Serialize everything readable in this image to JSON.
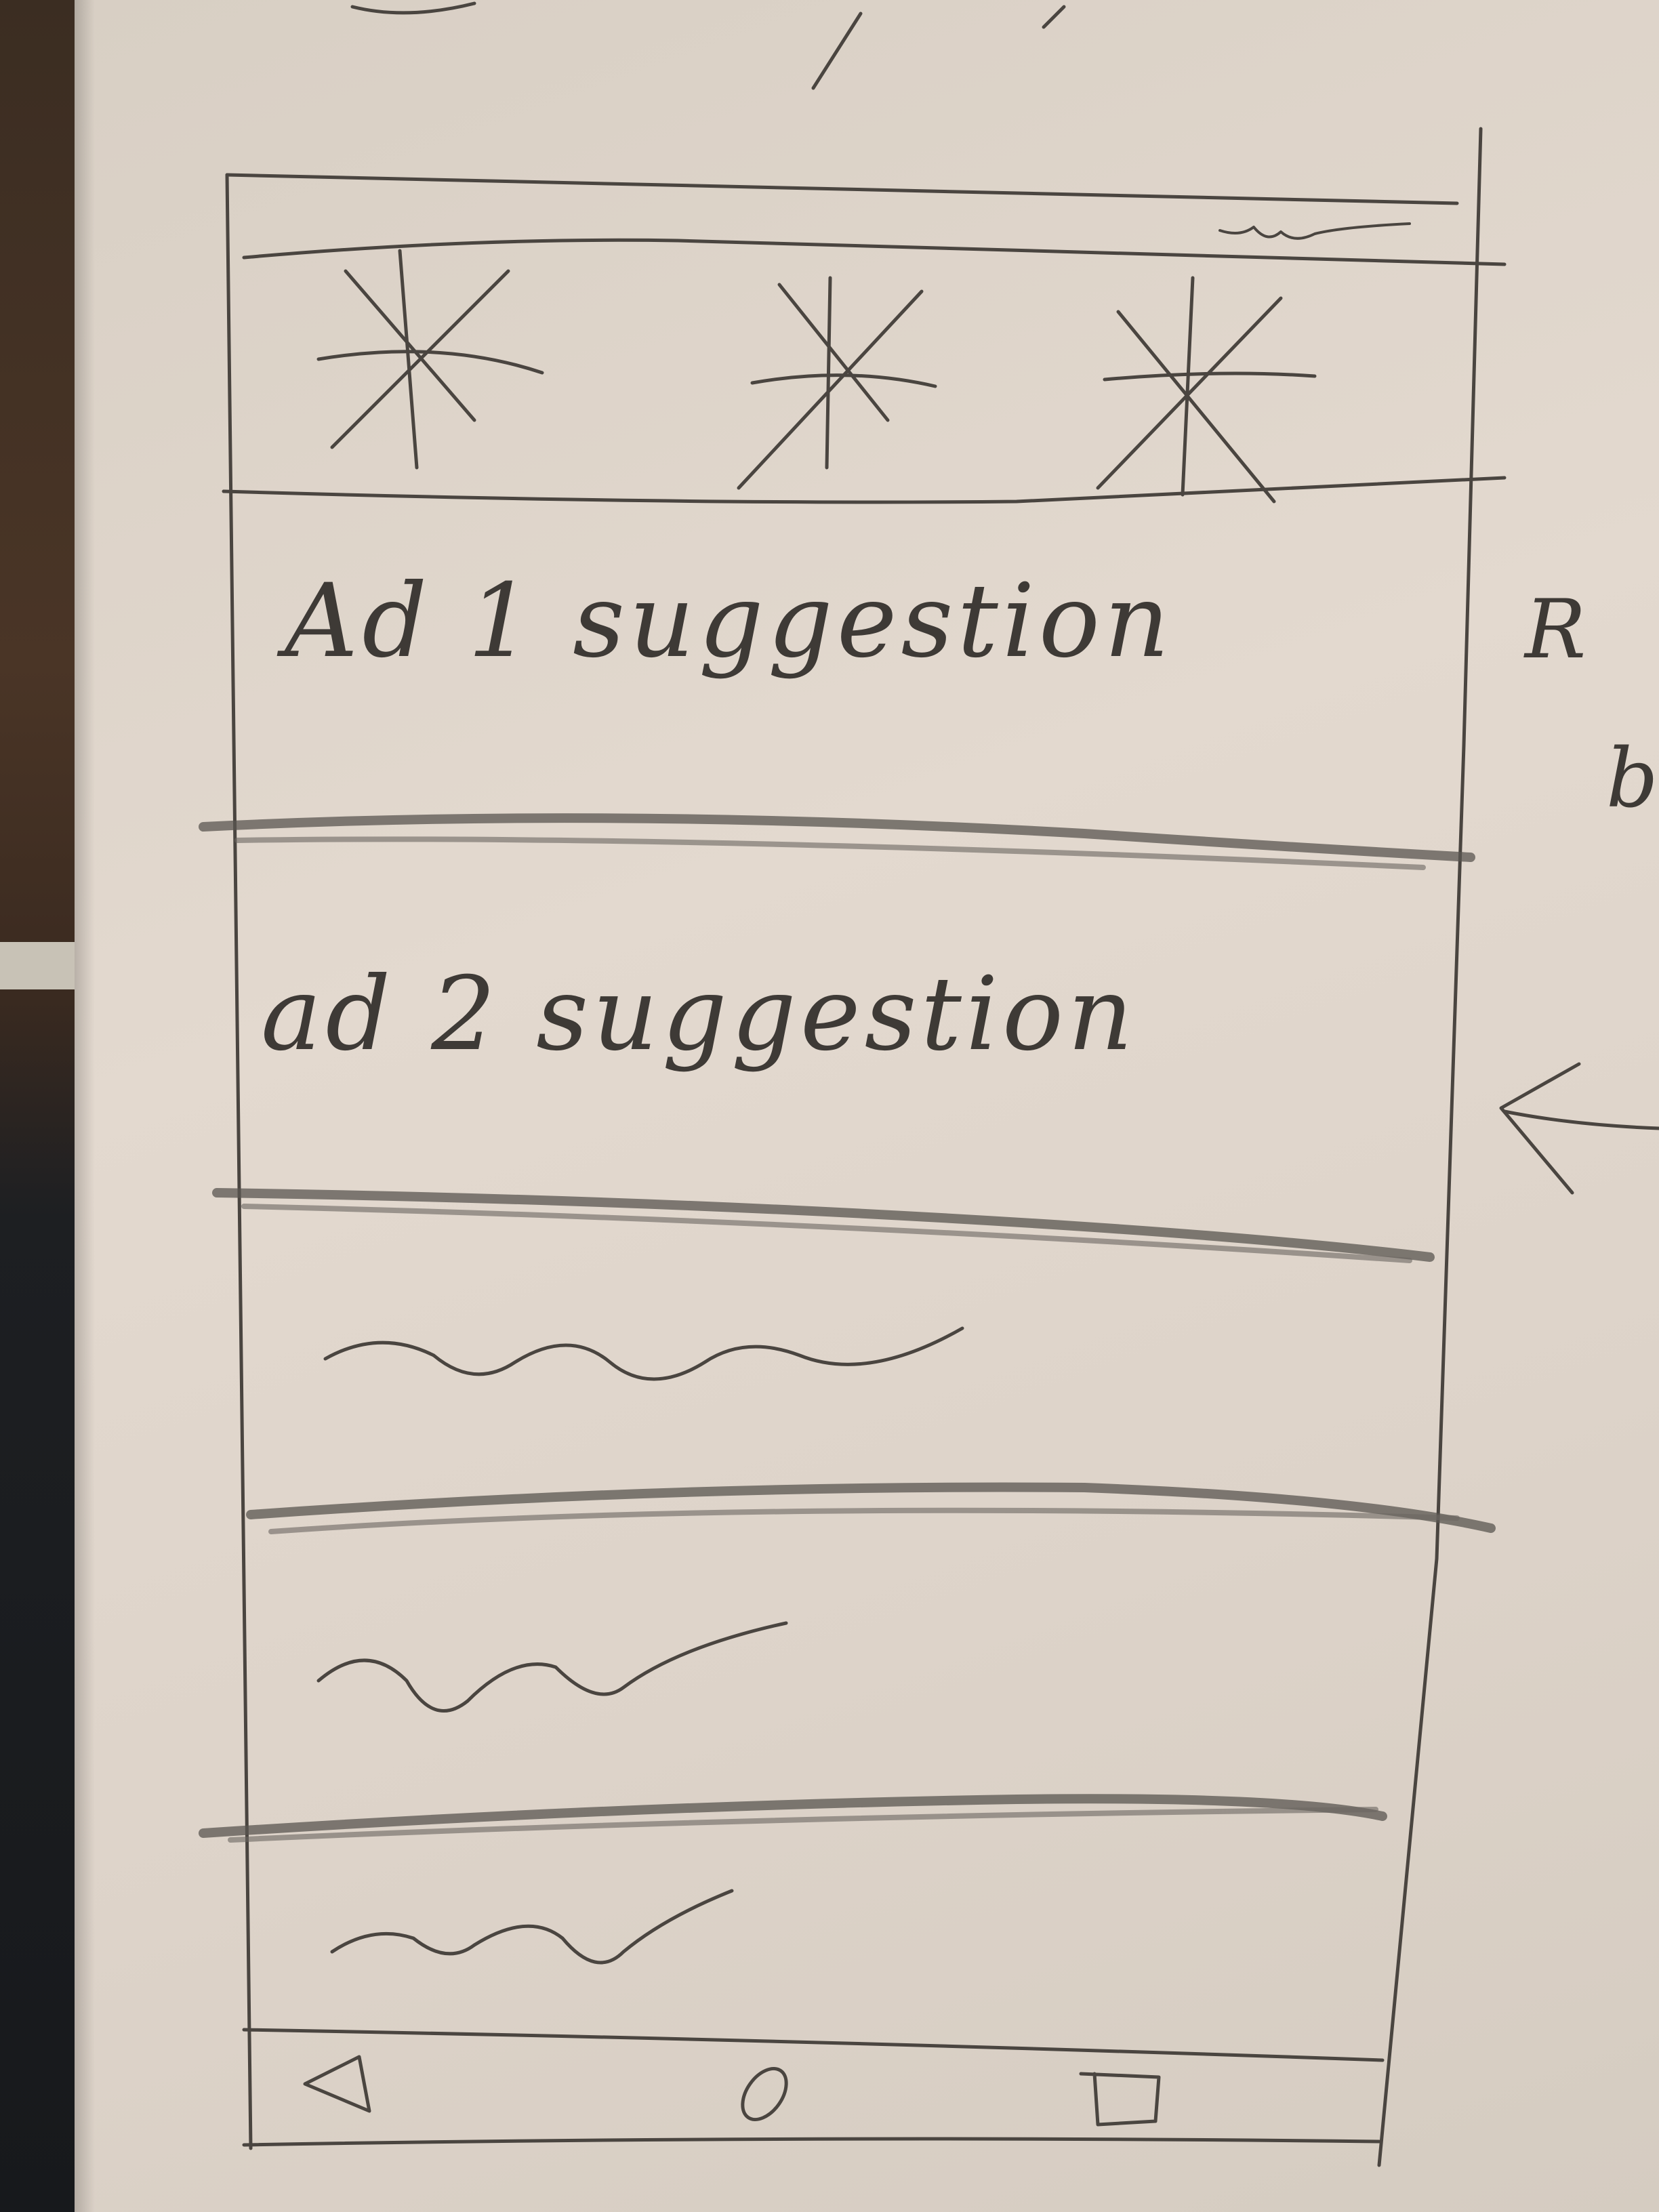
{
  "rows": [
    {
      "label": "Ad 1 suggestion"
    },
    {
      "label": "ad 2 suggestion"
    }
  ],
  "placeholder_rows": 3,
  "header": {
    "icons": [
      "asterisk-icon",
      "asterisk-icon",
      "asterisk-icon"
    ]
  },
  "nav": {
    "icons": [
      "back-triangle-icon",
      "home-circle-icon",
      "recents-square-icon"
    ]
  },
  "margin_notes": [
    "R",
    "b"
  ],
  "colors": {
    "paper": "#e0d7cd",
    "pencil": "#4a4540",
    "background": "#2a201a"
  }
}
